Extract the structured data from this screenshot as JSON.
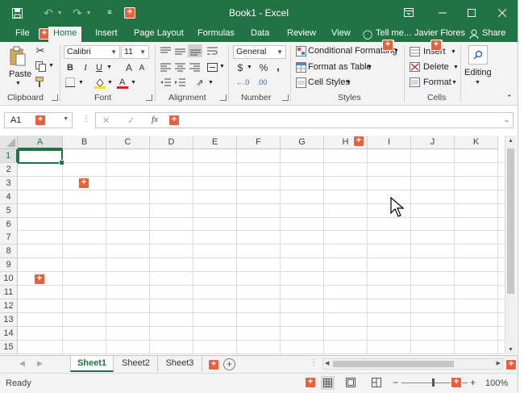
{
  "title_bar": {
    "title": "Book1  -  Excel",
    "icons": [
      "save-icon",
      "undo-icon",
      "redo-icon",
      "customize-qat-icon",
      "ribbon-display-icon",
      "minimize-icon",
      "maximize-icon",
      "close-icon"
    ]
  },
  "tabs": {
    "file": "File",
    "home": "Home",
    "insert": "Insert",
    "page_layout": "Page Layout",
    "formulas": "Formulas",
    "data": "Data",
    "review": "Review",
    "view": "View",
    "tell_me": "Tell me...",
    "user": "Javier Flores",
    "share": "Share"
  },
  "ribbon": {
    "clipboard": {
      "paste": "Paste",
      "label": "Clipboard"
    },
    "font": {
      "name": "Calibri",
      "size": "11",
      "bold": "B",
      "italic": "I",
      "underline": "U",
      "grow": "A",
      "shrink": "A",
      "label": "Font"
    },
    "alignment": {
      "label": "Alignment"
    },
    "number": {
      "format": "General",
      "currency": "$",
      "percent": "%",
      "comma": ",",
      "inc_dec": "←.0",
      "dec_dec": ".00",
      "label": "Number"
    },
    "styles": {
      "conditional": "Conditional Formatting",
      "format_table": "Format as Table",
      "cell_styles": "Cell Styles",
      "label": "Styles"
    },
    "cells": {
      "insert": "Insert",
      "delete": "Delete",
      "format": "Format",
      "label": "Cells"
    },
    "editing": {
      "label": "Editing"
    }
  },
  "formula_bar": {
    "name_box": "A1",
    "cancel": "✕",
    "enter": "✓",
    "fx": "fx",
    "value": ""
  },
  "grid": {
    "columns": [
      "A",
      "B",
      "C",
      "D",
      "E",
      "F",
      "G",
      "H",
      "I",
      "J",
      "K"
    ],
    "rows": [
      "1",
      "2",
      "3",
      "4",
      "5",
      "6",
      "7",
      "8",
      "9",
      "10",
      "11",
      "12",
      "13",
      "14",
      "15"
    ],
    "active_cell": "A1"
  },
  "sheets": {
    "tabs": [
      "Sheet1",
      "Sheet2",
      "Sheet3"
    ],
    "active": "Sheet1",
    "add": "+"
  },
  "status_bar": {
    "status": "Ready",
    "zoom": "100%",
    "zoom_out": "−",
    "zoom_in": "+"
  },
  "colors": {
    "brand": "#217346",
    "marker": "#e8613c"
  }
}
